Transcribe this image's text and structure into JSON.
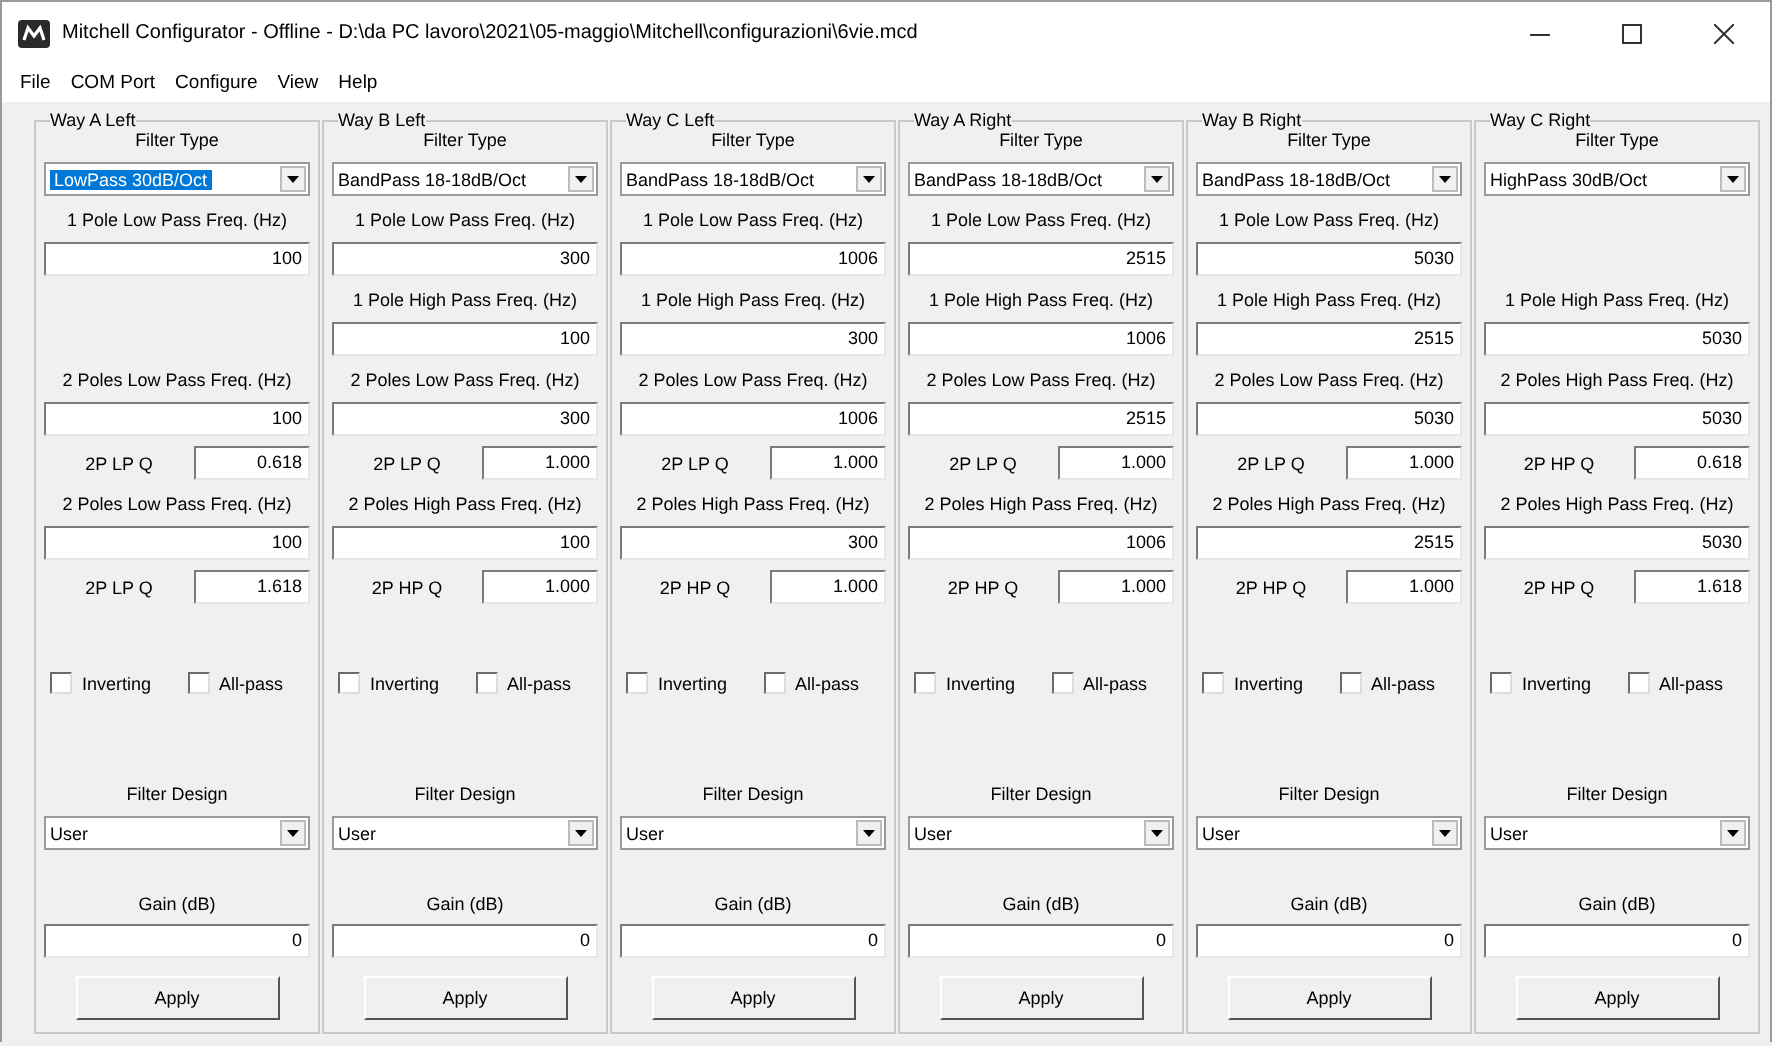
{
  "window": {
    "title": "Mitchell Configurator - Offline - D:\\da PC lavoro\\2021\\05-maggio\\Mitchell\\configurazioni\\6vie.mcd"
  },
  "menu": [
    "File",
    "COM Port",
    "Configure",
    "View",
    "Help"
  ],
  "groups": [
    {
      "title": "Way A Left",
      "filter_type_label": "Filter Type",
      "filter_type": {
        "value": "LowPass 30dB/Oct",
        "highlighted": true
      },
      "settings": [
        {
          "kind": "freq",
          "label": "1 Pole Low Pass Freq. (Hz)",
          "value": "100"
        },
        {
          "kind": "gap"
        },
        {
          "kind": "freq",
          "label": "2 Poles Low Pass Freq. (Hz)",
          "value": "100"
        },
        {
          "kind": "q",
          "label": "2P LP Q",
          "value": "0.618"
        },
        {
          "kind": "freq",
          "label": "2 Poles Low Pass Freq. (Hz)",
          "value": "100"
        },
        {
          "kind": "q",
          "label": "2P LP Q",
          "value": "1.618"
        }
      ],
      "inverting": {
        "label": "Inverting",
        "checked": false
      },
      "allpass": {
        "label": "All-pass",
        "checked": false
      },
      "design_label": "Filter Design",
      "design": "User",
      "gain_label": "Gain (dB)",
      "gain": "0",
      "apply": "Apply"
    },
    {
      "title": "Way B Left",
      "filter_type_label": "Filter Type",
      "filter_type": {
        "value": "BandPass 18-18dB/Oct",
        "highlighted": false
      },
      "settings": [
        {
          "kind": "freq",
          "label": "1 Pole Low Pass Freq. (Hz)",
          "value": "300"
        },
        {
          "kind": "freq",
          "label": "1 Pole High Pass Freq. (Hz)",
          "value": "100"
        },
        {
          "kind": "freq",
          "label": "2 Poles Low Pass Freq. (Hz)",
          "value": "300"
        },
        {
          "kind": "q",
          "label": "2P LP Q",
          "value": "1.000"
        },
        {
          "kind": "freq",
          "label": "2 Poles High Pass Freq. (Hz)",
          "value": "100"
        },
        {
          "kind": "q",
          "label": "2P HP Q",
          "value": "1.000"
        }
      ],
      "inverting": {
        "label": "Inverting",
        "checked": false
      },
      "allpass": {
        "label": "All-pass",
        "checked": false
      },
      "design_label": "Filter Design",
      "design": "User",
      "gain_label": "Gain (dB)",
      "gain": "0",
      "apply": "Apply"
    },
    {
      "title": "Way C Left",
      "filter_type_label": "Filter Type",
      "filter_type": {
        "value": "BandPass 18-18dB/Oct",
        "highlighted": false
      },
      "settings": [
        {
          "kind": "freq",
          "label": "1 Pole Low Pass Freq. (Hz)",
          "value": "1006"
        },
        {
          "kind": "freq",
          "label": "1 Pole High Pass Freq. (Hz)",
          "value": "300"
        },
        {
          "kind": "freq",
          "label": "2 Poles Low Pass Freq. (Hz)",
          "value": "1006"
        },
        {
          "kind": "q",
          "label": "2P LP Q",
          "value": "1.000"
        },
        {
          "kind": "freq",
          "label": "2 Poles High Pass Freq. (Hz)",
          "value": "300"
        },
        {
          "kind": "q",
          "label": "2P HP Q",
          "value": "1.000"
        }
      ],
      "inverting": {
        "label": "Inverting",
        "checked": false
      },
      "allpass": {
        "label": "All-pass",
        "checked": false
      },
      "design_label": "Filter Design",
      "design": "User",
      "gain_label": "Gain (dB)",
      "gain": "0",
      "apply": "Apply"
    },
    {
      "title": "Way A Right",
      "filter_type_label": "Filter Type",
      "filter_type": {
        "value": "BandPass 18-18dB/Oct",
        "highlighted": false
      },
      "settings": [
        {
          "kind": "freq",
          "label": "1 Pole Low Pass Freq. (Hz)",
          "value": "2515"
        },
        {
          "kind": "freq",
          "label": "1 Pole High Pass Freq. (Hz)",
          "value": "1006"
        },
        {
          "kind": "freq",
          "label": "2 Poles Low Pass Freq. (Hz)",
          "value": "2515"
        },
        {
          "kind": "q",
          "label": "2P LP Q",
          "value": "1.000"
        },
        {
          "kind": "freq",
          "label": "2 Poles High Pass Freq. (Hz)",
          "value": "1006"
        },
        {
          "kind": "q",
          "label": "2P HP Q",
          "value": "1.000"
        }
      ],
      "inverting": {
        "label": "Inverting",
        "checked": false
      },
      "allpass": {
        "label": "All-pass",
        "checked": false
      },
      "design_label": "Filter Design",
      "design": "User",
      "gain_label": "Gain (dB)",
      "gain": "0",
      "apply": "Apply"
    },
    {
      "title": "Way B Right",
      "filter_type_label": "Filter Type",
      "filter_type": {
        "value": "BandPass 18-18dB/Oct",
        "highlighted": false
      },
      "settings": [
        {
          "kind": "freq",
          "label": "1 Pole Low Pass Freq. (Hz)",
          "value": "5030"
        },
        {
          "kind": "freq",
          "label": "1 Pole High Pass Freq. (Hz)",
          "value": "2515"
        },
        {
          "kind": "freq",
          "label": "2 Poles Low Pass Freq. (Hz)",
          "value": "5030"
        },
        {
          "kind": "q",
          "label": "2P LP Q",
          "value": "1.000"
        },
        {
          "kind": "freq",
          "label": "2 Poles High Pass Freq. (Hz)",
          "value": "2515"
        },
        {
          "kind": "q",
          "label": "2P HP Q",
          "value": "1.000"
        }
      ],
      "inverting": {
        "label": "Inverting",
        "checked": false
      },
      "allpass": {
        "label": "All-pass",
        "checked": false
      },
      "design_label": "Filter Design",
      "design": "User",
      "gain_label": "Gain (dB)",
      "gain": "0",
      "apply": "Apply"
    },
    {
      "title": "Way C Right",
      "filter_type_label": "Filter Type",
      "filter_type": {
        "value": "HighPass 30dB/Oct",
        "highlighted": false
      },
      "settings": [
        {
          "kind": "gap"
        },
        {
          "kind": "freq",
          "label": "1 Pole High Pass Freq. (Hz)",
          "value": "5030"
        },
        {
          "kind": "freq",
          "label": "2 Poles High Pass Freq. (Hz)",
          "value": "5030"
        },
        {
          "kind": "q",
          "label": "2P HP Q",
          "value": "0.618"
        },
        {
          "kind": "freq",
          "label": "2 Poles High Pass Freq. (Hz)",
          "value": "5030"
        },
        {
          "kind": "q",
          "label": "2P HP Q",
          "value": "1.618"
        }
      ],
      "inverting": {
        "label": "Inverting",
        "checked": false
      },
      "allpass": {
        "label": "All-pass",
        "checked": false
      },
      "design_label": "Filter Design",
      "design": "User",
      "gain_label": "Gain (dB)",
      "gain": "0",
      "apply": "Apply"
    }
  ]
}
